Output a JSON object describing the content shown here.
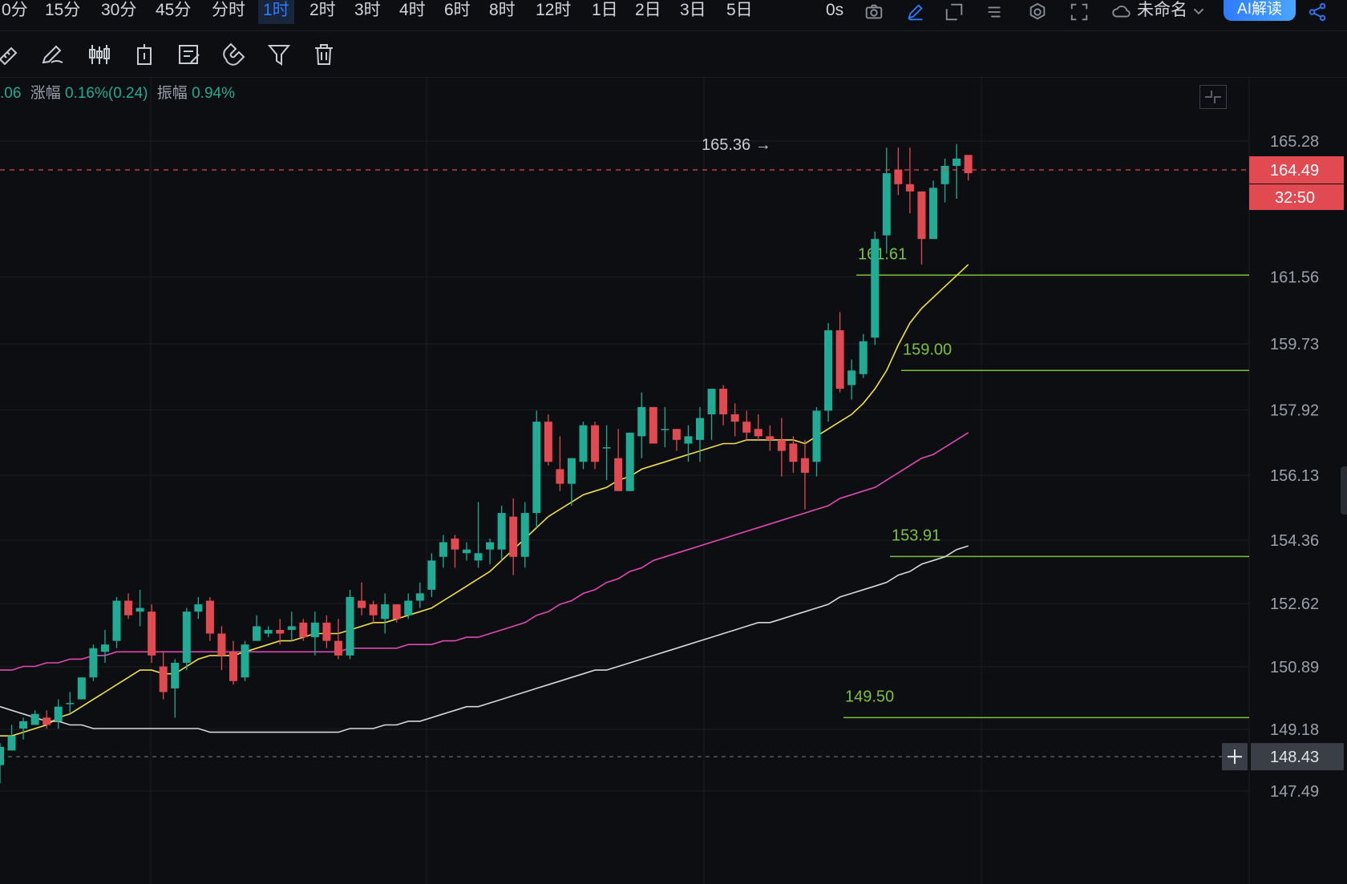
{
  "timeframes": [
    "0分",
    "15分",
    "30分",
    "45分",
    "分时",
    "1时",
    "2时",
    "3时",
    "4时",
    "6时",
    "8时",
    "12时",
    "1日",
    "2日",
    "3日",
    "5日"
  ],
  "active_timeframe": "1时",
  "topbar": {
    "refresh_label": "0s",
    "layout_name": "未命名",
    "ai_button": "AI解读",
    "icons": [
      "camera-icon",
      "pencil-icon",
      "new-window-icon",
      "list-icon",
      "settings-icon",
      "fullscreen-icon",
      "cloud-icon",
      "chevron-down-icon",
      "share-icon"
    ]
  },
  "toolbar": {
    "icons": [
      "ruler-icon",
      "draw-pencil-icon",
      "candlestick-icon",
      "trade-icon",
      "notes-icon",
      "magnet-icon",
      "filter-icon",
      "trash-icon"
    ]
  },
  "info": {
    "prefix": ".06",
    "change_label": "涨幅",
    "change_value": "0.16%(0.24)",
    "amplitude_label": "振幅",
    "amplitude_value": "0.94%"
  },
  "colors": {
    "up": "#22ab94",
    "down": "#e04a50",
    "ma_short": "#f0e04a",
    "ma_mid": "#e04ab4",
    "ma_long": "#d8d8d8",
    "level_line": "#7cc13a",
    "price_badge": "#e04a50"
  },
  "chart_data": {
    "type": "candlestick",
    "interval": "1时",
    "y_ticks": [
      "165.28",
      "161.56",
      "159.73",
      "157.92",
      "156.13",
      "154.36",
      "152.62",
      "150.89",
      "149.18",
      "147.49"
    ],
    "ylim": [
      147.0,
      166.5
    ],
    "last_price": "164.49",
    "countdown": "32:50",
    "crosshair_price": "148.43",
    "high_label": "165.36",
    "levels": [
      {
        "value": 161.61,
        "label": "161.61"
      },
      {
        "value": 159.0,
        "label": "159.00"
      },
      {
        "value": 153.91,
        "label": "153.91"
      },
      {
        "value": 149.5,
        "label": "149.50"
      }
    ],
    "candles": [
      [
        148.2,
        148.8,
        147.7,
        148.7
      ],
      [
        148.6,
        149.3,
        148.6,
        149.0
      ],
      [
        149.2,
        149.5,
        148.9,
        149.4
      ],
      [
        149.3,
        149.7,
        149.3,
        149.6
      ],
      [
        149.5,
        149.7,
        149.2,
        149.3
      ],
      [
        149.4,
        150.0,
        149.2,
        149.8
      ],
      [
        149.9,
        150.2,
        149.6,
        149.9
      ],
      [
        150.0,
        150.6,
        150.0,
        150.6
      ],
      [
        150.6,
        151.5,
        150.5,
        151.4
      ],
      [
        151.3,
        151.9,
        151.0,
        151.5
      ],
      [
        151.6,
        152.8,
        151.4,
        152.7
      ],
      [
        152.7,
        152.9,
        152.2,
        152.3
      ],
      [
        152.4,
        153.0,
        152.0,
        152.5
      ],
      [
        152.4,
        152.6,
        151.0,
        151.2
      ],
      [
        150.9,
        151.3,
        150.0,
        150.2
      ],
      [
        150.3,
        151.1,
        149.5,
        151.0
      ],
      [
        151.0,
        152.5,
        150.8,
        152.4
      ],
      [
        152.4,
        152.8,
        152.2,
        152.6
      ],
      [
        152.7,
        152.8,
        151.6,
        151.8
      ],
      [
        151.8,
        152.0,
        150.8,
        151.2
      ],
      [
        151.3,
        151.6,
        150.4,
        150.5
      ],
      [
        150.6,
        151.6,
        150.5,
        151.5
      ],
      [
        151.6,
        152.3,
        151.6,
        152.0
      ],
      [
        151.8,
        152.0,
        151.7,
        151.9
      ],
      [
        151.9,
        152.2,
        151.5,
        151.8
      ],
      [
        151.9,
        152.4,
        151.6,
        152.0
      ],
      [
        152.1,
        152.2,
        151.6,
        151.7
      ],
      [
        151.7,
        152.4,
        151.2,
        152.1
      ],
      [
        152.1,
        152.3,
        151.4,
        151.6
      ],
      [
        151.6,
        152.2,
        151.1,
        151.2
      ],
      [
        151.2,
        153.0,
        151.1,
        152.8
      ],
      [
        152.7,
        153.2,
        152.3,
        152.5
      ],
      [
        152.6,
        152.7,
        152.1,
        152.3
      ],
      [
        152.2,
        152.9,
        151.8,
        152.6
      ],
      [
        152.6,
        152.6,
        152.1,
        152.2
      ],
      [
        152.3,
        152.9,
        152.2,
        152.7
      ],
      [
        152.7,
        153.2,
        152.5,
        152.9
      ],
      [
        153.0,
        154.0,
        152.8,
        153.8
      ],
      [
        153.9,
        154.5,
        153.6,
        154.3
      ],
      [
        154.4,
        154.5,
        153.6,
        154.1
      ],
      [
        154.0,
        154.3,
        153.8,
        154.1
      ],
      [
        153.8,
        155.4,
        153.6,
        154.0
      ],
      [
        154.1,
        154.4,
        153.7,
        154.3
      ],
      [
        154.1,
        155.3,
        153.8,
        155.1
      ],
      [
        155.0,
        155.5,
        153.4,
        153.9
      ],
      [
        153.9,
        155.4,
        153.6,
        155.1
      ],
      [
        155.1,
        157.9,
        154.7,
        157.6
      ],
      [
        157.6,
        157.8,
        156.4,
        156.5
      ],
      [
        156.3,
        157.2,
        155.7,
        155.9
      ],
      [
        155.9,
        156.6,
        155.3,
        156.6
      ],
      [
        156.5,
        157.6,
        156.3,
        157.5
      ],
      [
        157.5,
        157.6,
        156.3,
        156.5
      ],
      [
        156.9,
        157.5,
        156.0,
        156.9
      ],
      [
        156.6,
        157.4,
        155.7,
        155.7
      ],
      [
        155.7,
        157.0,
        155.7,
        157.3
      ],
      [
        157.2,
        158.4,
        156.6,
        158.0
      ],
      [
        158.0,
        158.0,
        157.1,
        157.0
      ],
      [
        157.4,
        158.0,
        156.9,
        157.4
      ],
      [
        157.4,
        157.4,
        156.8,
        157.1
      ],
      [
        157.0,
        157.5,
        156.5,
        157.2
      ],
      [
        157.1,
        158.0,
        156.5,
        157.7
      ],
      [
        157.8,
        158.5,
        157.1,
        158.5
      ],
      [
        158.5,
        158.6,
        157.5,
        157.8
      ],
      [
        157.8,
        158.1,
        157.2,
        157.6
      ],
      [
        157.6,
        157.9,
        157.1,
        157.3
      ],
      [
        157.4,
        157.8,
        157.1,
        157.2
      ],
      [
        157.2,
        157.5,
        156.8,
        157.1
      ],
      [
        157.1,
        157.7,
        156.1,
        156.8
      ],
      [
        157.0,
        157.2,
        156.2,
        156.5
      ],
      [
        156.6,
        157.1,
        155.2,
        156.2
      ],
      [
        156.5,
        158.0,
        156.1,
        157.9
      ],
      [
        157.9,
        160.3,
        157.6,
        160.1
      ],
      [
        160.1,
        160.6,
        158.4,
        158.5
      ],
      [
        158.6,
        159.3,
        158.2,
        159.0
      ],
      [
        158.9,
        160.0,
        158.8,
        159.8
      ],
      [
        159.9,
        162.8,
        159.7,
        162.6
      ],
      [
        162.7,
        165.1,
        162.2,
        164.4
      ],
      [
        164.5,
        165.1,
        163.8,
        164.1
      ],
      [
        164.1,
        165.1,
        163.3,
        163.9
      ],
      [
        163.9,
        163.9,
        161.9,
        162.6
      ],
      [
        162.6,
        164.2,
        162.6,
        164.0
      ],
      [
        164.1,
        164.8,
        163.6,
        164.6
      ],
      [
        164.6,
        165.2,
        163.7,
        164.8
      ],
      [
        164.9,
        164.9,
        164.2,
        164.4
      ]
    ],
    "ma_short": [
      149.0,
      149.0,
      149.1,
      149.2,
      149.3,
      149.5,
      149.6,
      149.8,
      150.0,
      150.2,
      150.4,
      150.6,
      150.8,
      150.8,
      150.7,
      150.7,
      150.9,
      151.1,
      151.2,
      151.2,
      151.2,
      151.3,
      151.4,
      151.5,
      151.6,
      151.6,
      151.7,
      151.8,
      151.8,
      151.8,
      151.9,
      152.0,
      152.1,
      152.1,
      152.2,
      152.3,
      152.4,
      152.5,
      152.7,
      152.9,
      153.1,
      153.3,
      153.5,
      153.8,
      154.1,
      154.4,
      154.7,
      155.0,
      155.2,
      155.4,
      155.6,
      155.7,
      155.8,
      156.0,
      156.1,
      156.3,
      156.4,
      156.5,
      156.6,
      156.7,
      156.8,
      156.9,
      157.0,
      157.0,
      157.1,
      157.1,
      157.1,
      157.1,
      157.1,
      157.0,
      157.2,
      157.4,
      157.6,
      157.8,
      158.1,
      158.5,
      159.0,
      159.7,
      160.3,
      160.7,
      161.0,
      161.3,
      161.6,
      161.9
    ],
    "ma_mid": [
      150.8,
      150.8,
      150.9,
      150.9,
      151.0,
      151.0,
      151.1,
      151.1,
      151.2,
      151.2,
      151.3,
      151.3,
      151.3,
      151.3,
      151.3,
      151.3,
      151.3,
      151.3,
      151.3,
      151.3,
      151.3,
      151.3,
      151.3,
      151.3,
      151.3,
      151.3,
      151.3,
      151.3,
      151.3,
      151.3,
      151.4,
      151.4,
      151.4,
      151.4,
      151.4,
      151.5,
      151.5,
      151.5,
      151.6,
      151.6,
      151.7,
      151.7,
      151.8,
      151.9,
      152.0,
      152.1,
      152.3,
      152.4,
      152.6,
      152.7,
      152.9,
      153.0,
      153.2,
      153.3,
      153.5,
      153.6,
      153.8,
      153.9,
      154.0,
      154.1,
      154.2,
      154.3,
      154.4,
      154.5,
      154.6,
      154.7,
      154.8,
      154.9,
      155.0,
      155.1,
      155.2,
      155.3,
      155.5,
      155.6,
      155.7,
      155.8,
      156.0,
      156.2,
      156.4,
      156.6,
      156.7,
      156.9,
      157.1,
      157.3
    ],
    "ma_long": [
      149.8,
      149.7,
      149.6,
      149.5,
      149.4,
      149.4,
      149.3,
      149.3,
      149.2,
      149.2,
      149.2,
      149.2,
      149.2,
      149.2,
      149.2,
      149.2,
      149.2,
      149.2,
      149.1,
      149.1,
      149.1,
      149.1,
      149.1,
      149.1,
      149.1,
      149.1,
      149.1,
      149.1,
      149.1,
      149.1,
      149.2,
      149.2,
      149.2,
      149.3,
      149.3,
      149.4,
      149.4,
      149.5,
      149.6,
      149.7,
      149.8,
      149.8,
      149.9,
      150.0,
      150.1,
      150.2,
      150.3,
      150.4,
      150.5,
      150.6,
      150.7,
      150.8,
      150.8,
      150.9,
      151.0,
      151.1,
      151.2,
      151.3,
      151.4,
      151.5,
      151.6,
      151.7,
      151.8,
      151.9,
      152.0,
      152.1,
      152.1,
      152.2,
      152.3,
      152.4,
      152.5,
      152.6,
      152.8,
      152.9,
      153.0,
      153.1,
      153.2,
      153.4,
      153.5,
      153.7,
      153.8,
      153.9,
      154.1,
      154.2
    ]
  }
}
